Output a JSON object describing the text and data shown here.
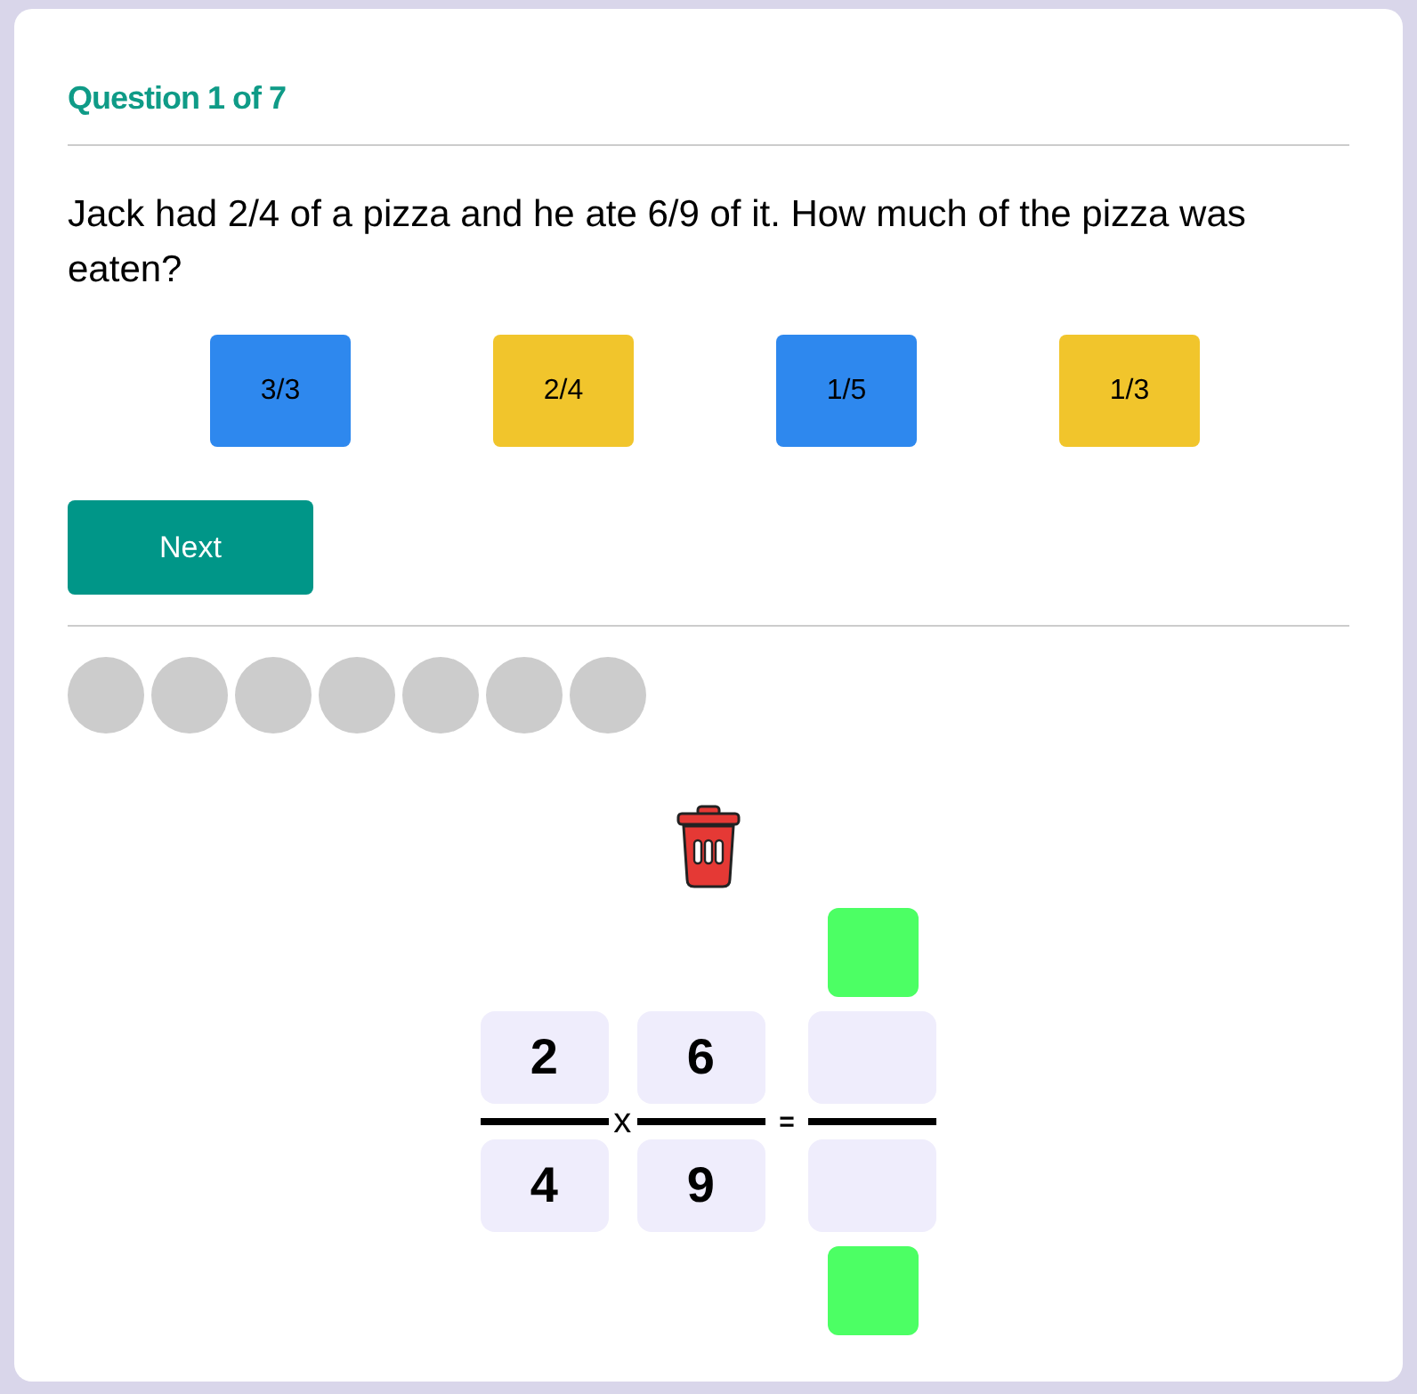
{
  "header": {
    "title": "Question 1 of 7"
  },
  "question": "Jack had 2/4 of a pizza and he ate 6/9 of it. How much of the pizza was eaten?",
  "options": [
    {
      "label": "3/3",
      "color": "#2e88ee"
    },
    {
      "label": "2/4",
      "color": "#f1c52c"
    },
    {
      "label": "1/5",
      "color": "#2e88ee"
    },
    {
      "label": "1/3",
      "color": "#f1c52c"
    }
  ],
  "next_button": "Next",
  "progress": [
    {
      "filled": false
    },
    {
      "filled": false
    },
    {
      "filled": false
    },
    {
      "filled": false
    },
    {
      "filled": false
    },
    {
      "filled": false
    },
    {
      "filled": false
    }
  ],
  "equation": {
    "operands": [
      {
        "numerator": "2",
        "denominator": "4"
      },
      {
        "numerator": "6",
        "denominator": "9"
      }
    ],
    "operators": [
      "x",
      "="
    ]
  }
}
